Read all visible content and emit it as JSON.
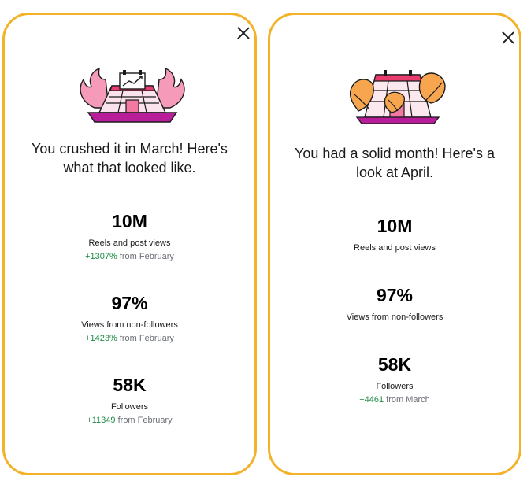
{
  "cards": [
    {
      "headline": "You crushed it in March! Here's what that looked like.",
      "illustration": "calendar-flames-icon",
      "stats": [
        {
          "value": "10M",
          "label": "Reels and post views",
          "delta": "+1307%",
          "delta_suffix": "from February"
        },
        {
          "value": "97%",
          "label": "Views from non-followers",
          "delta": "+1423%",
          "delta_suffix": "from February"
        },
        {
          "value": "58K",
          "label": "Followers",
          "delta": "+11349",
          "delta_suffix": "from February"
        }
      ]
    },
    {
      "headline": "You had a solid month! Here's a look at April.",
      "illustration": "calendar-leaves-icon",
      "stats": [
        {
          "value": "10M",
          "label": "Reels and post views"
        },
        {
          "value": "97%",
          "label": "Views from non-followers"
        },
        {
          "value": "58K",
          "label": "Followers",
          "delta": "+4461",
          "delta_suffix": "from March"
        }
      ]
    }
  ],
  "colors": {
    "card_border": "#f2b32a",
    "positive_delta": "#1e8a44",
    "muted_text": "#6b6f76",
    "flame_pink": "#f59ab8",
    "calendar_magenta": "#b81d9a",
    "leaf_orange": "#f7a64f"
  }
}
